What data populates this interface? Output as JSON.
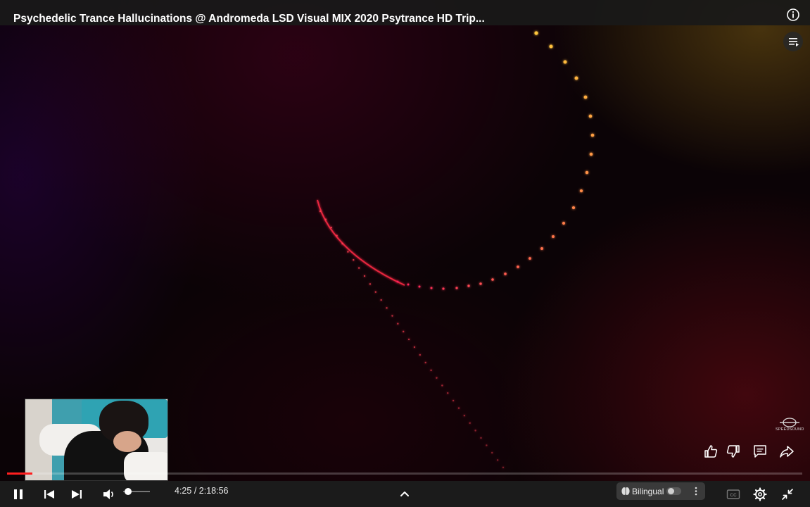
{
  "video": {
    "title": "Psychedelic Trance Hallucinations @ Andromeda LSD Visual MIX 2020 Psytrance HD Trip...",
    "watermark": "SPEEDSOUND"
  },
  "icons": {
    "info": "info-icon",
    "playlist": "playlist-icon",
    "like": "thumbs-up-icon",
    "dislike": "thumbs-down-icon",
    "comments": "comment-icon",
    "share": "share-icon",
    "pause": "pause-icon",
    "previous": "skip-previous-icon",
    "next": "skip-next-icon",
    "volume": "volume-icon",
    "expand": "chevron-up-icon",
    "bilingual": "brain-icon",
    "more": "more-vertical-icon",
    "captions": "cc-icon",
    "settings": "gear-icon",
    "exit_fullscreen": "collapse-icon"
  },
  "player": {
    "current_time": "4:25",
    "duration": "2:18:56",
    "time_display": "4:25 / 2:18:56",
    "progress_fraction": 0.032,
    "volume_fraction": 0.15,
    "bilingual_label": "Bilingual",
    "bilingual_enabled": false
  },
  "colors": {
    "progress": "#ff1f1f",
    "controls_bg": "#1b1b1b"
  }
}
